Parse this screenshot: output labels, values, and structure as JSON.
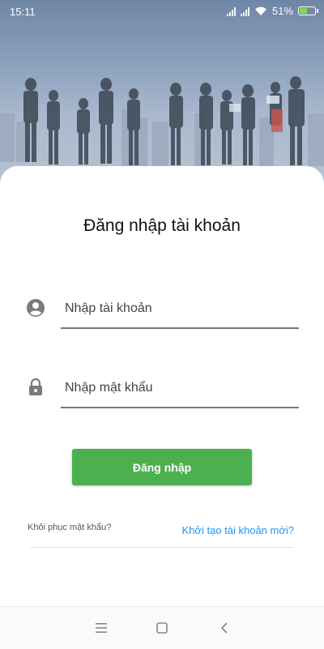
{
  "status_bar": {
    "time": "15:11",
    "battery_percent": "51%",
    "battery_level": 0.51,
    "icons": [
      "signal-icon",
      "signal-icon",
      "wifi-icon",
      "battery-charging-icon"
    ]
  },
  "hero": {
    "image": "business-people-skyline-photo"
  },
  "login": {
    "title": "Đăng nhập tài khoản",
    "username": {
      "placeholder": "Nhập tài khoản",
      "value": "",
      "icon": "account-circle-icon"
    },
    "password": {
      "placeholder": "Nhập mật khẩu",
      "value": "",
      "icon": "lock-icon"
    },
    "submit_label": "Đăng nhập",
    "forgot_label": "Khôi phục mật khẩu?",
    "create_label": "Khởi tạo tài khoản mới?"
  },
  "colors": {
    "accent": "#4caf50",
    "link": "#2196f3"
  },
  "navbar": {
    "icons": [
      "menu-icon",
      "home-square-icon",
      "back-icon"
    ]
  }
}
